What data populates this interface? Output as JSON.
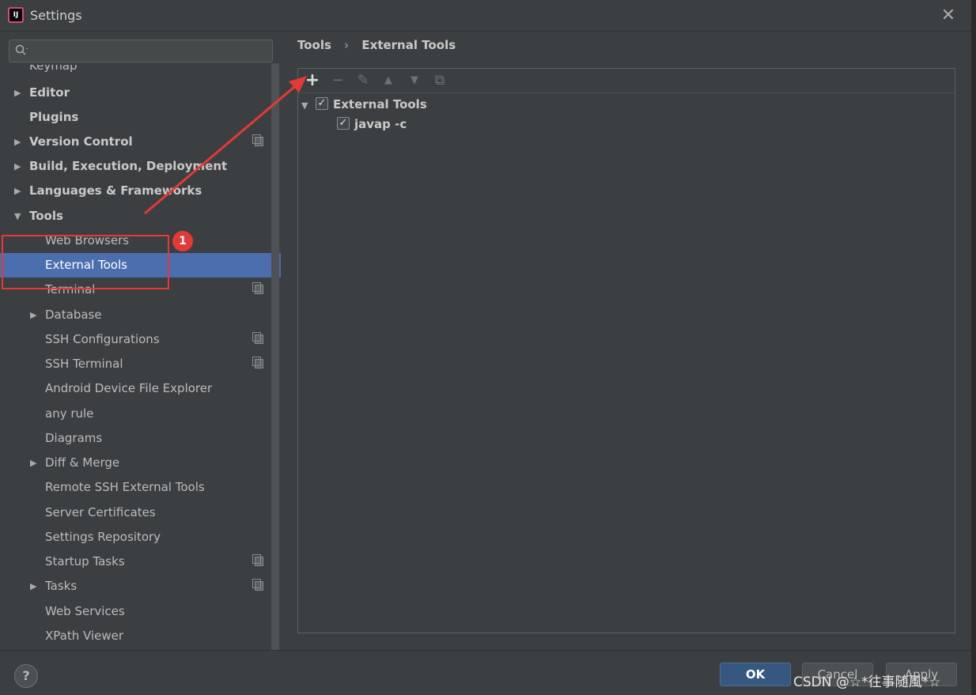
{
  "window": {
    "title": "Settings",
    "app_icon_text": "IJ"
  },
  "search": {
    "placeholder": ""
  },
  "sidebar": {
    "partial_top": "Keymap",
    "items": [
      {
        "label": "Editor"
      },
      {
        "label": "Plugins"
      },
      {
        "label": "Version Control"
      },
      {
        "label": "Build, Execution, Deployment"
      },
      {
        "label": "Languages & Frameworks"
      },
      {
        "label": "Tools"
      },
      {
        "label": "Web Browsers"
      },
      {
        "label": "External Tools"
      },
      {
        "label": "Terminal"
      },
      {
        "label": "Database"
      },
      {
        "label": "SSH Configurations"
      },
      {
        "label": "SSH Terminal"
      },
      {
        "label": "Android Device File Explorer"
      },
      {
        "label": "any rule"
      },
      {
        "label": "Diagrams"
      },
      {
        "label": "Diff & Merge"
      },
      {
        "label": "Remote SSH External Tools"
      },
      {
        "label": "Server Certificates"
      },
      {
        "label": "Settings Repository"
      },
      {
        "label": "Startup Tasks"
      },
      {
        "label": "Tasks"
      },
      {
        "label": "Web Services"
      },
      {
        "label": "XPath Viewer"
      }
    ]
  },
  "breadcrumb": {
    "parent": "Tools",
    "separator": "›",
    "current": "External Tools"
  },
  "toolbar": {
    "add": "+",
    "remove": "−",
    "edit": "✎",
    "up": "▲",
    "down": "▼",
    "copy": "⧉"
  },
  "tree": {
    "group": {
      "label": "External Tools",
      "checked": true
    },
    "children": [
      {
        "label": "javap -c",
        "checked": true
      }
    ]
  },
  "footer": {
    "help": "?",
    "ok": "OK",
    "cancel": "Cancel",
    "apply": "Apply"
  },
  "annotation": {
    "badge": "1"
  },
  "watermark": "CSDN @☆*往事随風*☆",
  "colors": {
    "selection": "#4b6eaf",
    "annotation": "#e53935",
    "ok_button": "#365880"
  }
}
